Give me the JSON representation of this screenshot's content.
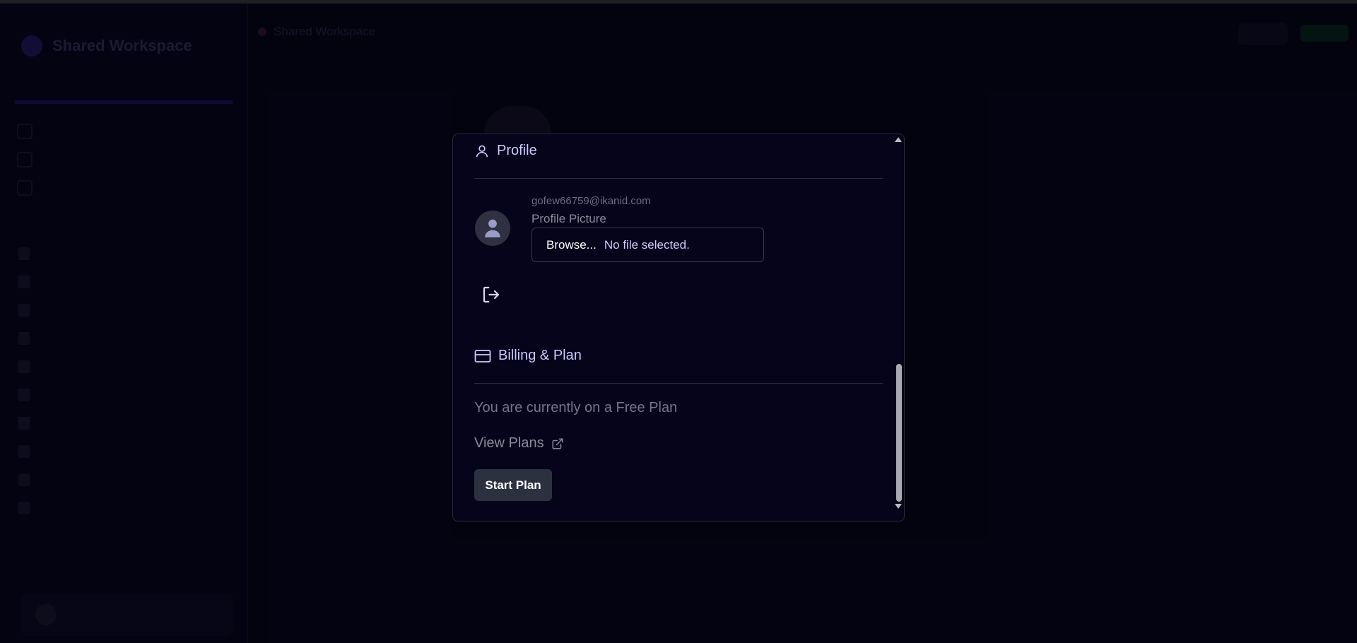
{
  "background": {
    "workspace_name": "Shared Workspace",
    "main_title": "Shared Workspace"
  },
  "modal": {
    "profile": {
      "heading": "Profile",
      "email": "gofew66759@ikanid.com",
      "picture_label": "Profile Picture",
      "browse_label": "Browse...",
      "file_status": "No file selected."
    },
    "billing": {
      "heading": "Billing & Plan",
      "plan_text": "You are currently on a Free Plan",
      "view_plans_label": "View Plans",
      "start_plan_label": "Start Plan"
    }
  },
  "colors": {
    "background": "#06051a",
    "modal_background": "#05041a",
    "accent_text": "#ccc8ff",
    "button_bg": "#2c3140"
  }
}
